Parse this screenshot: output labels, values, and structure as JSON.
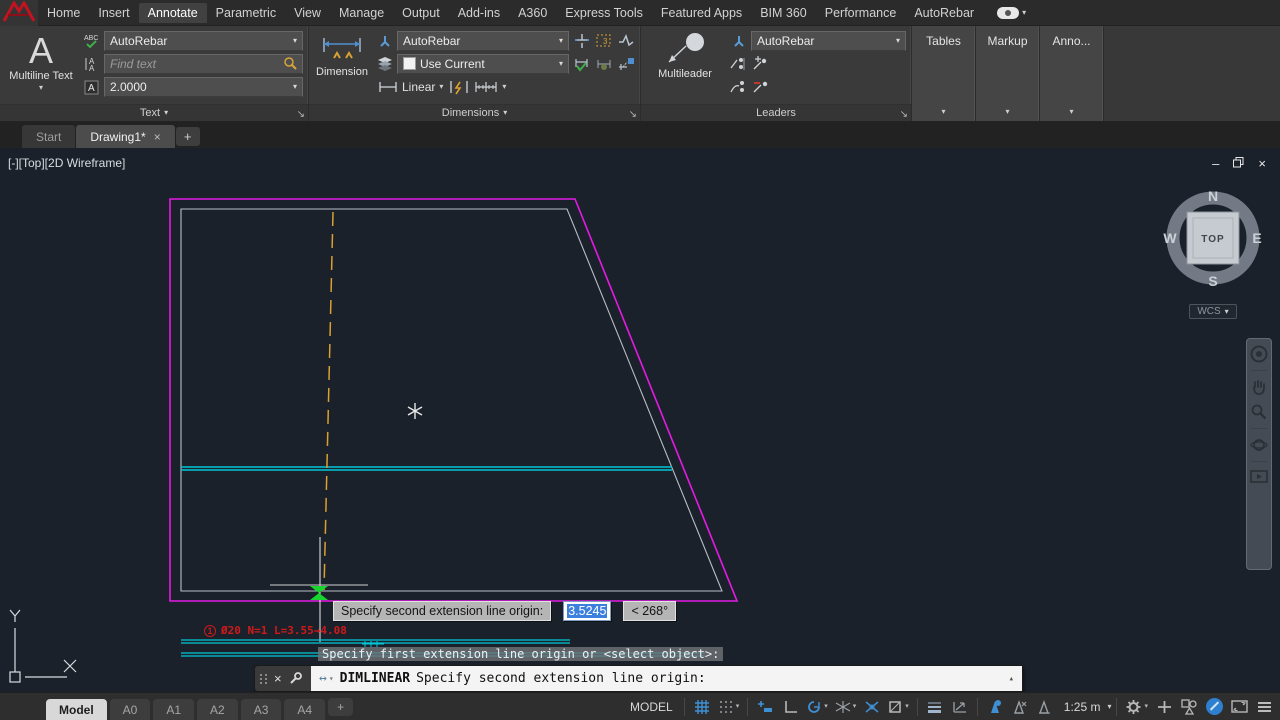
{
  "menubar": {
    "items": [
      "Home",
      "Insert",
      "Annotate",
      "Parametric",
      "View",
      "Manage",
      "Output",
      "Add-ins",
      "A360",
      "Express Tools",
      "Featured Apps",
      "BIM 360",
      "Performance",
      "AutoRebar"
    ],
    "active_item": "Annotate"
  },
  "ribbon": {
    "text_panel": {
      "title": "Text",
      "big_button_label": "Multiline Text",
      "big_icon_glyph": "A",
      "abc_icon_glyph": "ABC",
      "style_value": "AutoRebar",
      "find_placeholder": "Find text",
      "height_value": "2.0000"
    },
    "dimensions_panel": {
      "title": "Dimensions",
      "big_button_label": "Dimension",
      "style_value": "AutoRebar",
      "layer_value": "Use Current",
      "linear_label": "Linear"
    },
    "leaders_panel": {
      "title": "Leaders",
      "big_button_label": "Multileader",
      "style_value": "AutoRebar"
    },
    "collapsed_panels": [
      "Tables",
      "Markup",
      "Anno..."
    ]
  },
  "file_tabs": {
    "tabs": [
      {
        "label": "Start",
        "active": false
      },
      {
        "label": "Drawing1*",
        "active": true
      }
    ],
    "new_tab_label": "+"
  },
  "viewport": {
    "label": "[-][Top][2D Wireframe]",
    "compass": {
      "n": "N",
      "w": "W",
      "e": "E",
      "s": "S",
      "face": "TOP"
    },
    "wcs_label": "WCS"
  },
  "drawing": {
    "ucs": {
      "x": "X",
      "y": "Y"
    },
    "rebar_label_index": "1",
    "rebar_label": "Ø20 N=1 L=3.55→4.08",
    "prompt_remnant": "Specify first extension line origin or <select object>:",
    "tooltip": {
      "prompt": "Specify second extension line origin:",
      "value": "3.5245",
      "angle": "< 268°"
    }
  },
  "command_line": {
    "command": "DIMLINEAR",
    "prompt": "Specify second extension line origin:"
  },
  "status_bar": {
    "layout_tabs": [
      "Model",
      "A0",
      "A1",
      "A2",
      "A3",
      "A4"
    ],
    "active_layout_tab": "Model",
    "new_layout_label": "+",
    "model_label": "MODEL",
    "scale": "1:25 m"
  },
  "icons": {
    "chevron_down": "▾",
    "chevron_up": "▴",
    "close": "×",
    "minimize": "–",
    "dynamic_input": "↔",
    "launcher": "↘"
  },
  "colors": {
    "boundary_magenta": "#e51ae5",
    "edge_gray": "#b7bec6",
    "rebar_cyan": "#00c8d7",
    "centerline_orange": "#d9a032",
    "snap_green": "#17d42e",
    "rebar_text_red": "#cf1a1a",
    "status_blue": "#3f8fd4"
  }
}
